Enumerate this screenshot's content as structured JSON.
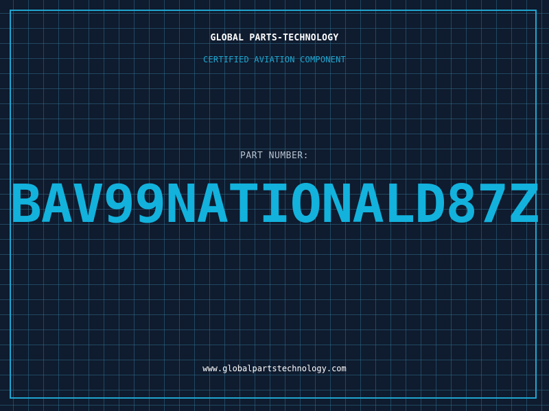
{
  "header": {
    "company_name": "GLOBAL PARTS-TECHNOLOGY",
    "subtitle": "CERTIFIED AVIATION COMPONENT"
  },
  "main": {
    "label": "PART NUMBER:",
    "part_number": "BAV99NATIONALD87Z"
  },
  "footer": {
    "website": "www.globalpartstechnology.com"
  },
  "colors": {
    "background": "#0f1b2e",
    "grid": "#2e6e8c",
    "accent": "#1fa6d0",
    "part_number": "#12b2dd",
    "text": "#ffffff",
    "label": "#b7c3cf"
  }
}
